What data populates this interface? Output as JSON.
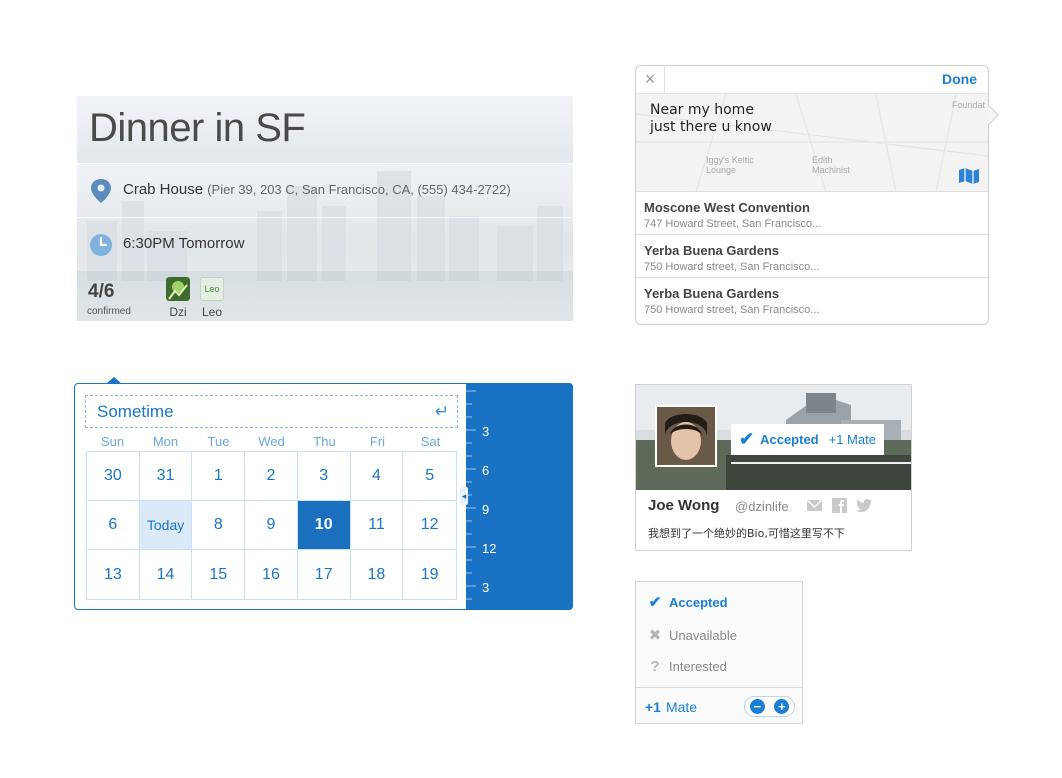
{
  "event": {
    "title": "Dinner in SF",
    "place_name": "Crab House",
    "place_detail": "(Pier 39, 203 C, San Francisco, CA, (555) 434-2722)",
    "time": "6:30PM Tomorrow",
    "confirmed_count": "4/6",
    "confirmed_label": "confirmed",
    "attendees": [
      {
        "name": "Dzi",
        "avatar_label": ""
      },
      {
        "name": "Leo",
        "avatar_label": "Leo"
      }
    ]
  },
  "location_popover": {
    "close_icon": "×",
    "done_label": "Done",
    "note": "Near my home\njust there u know",
    "map_labels": [
      "Iggy's Keltic Lounge",
      "Edith Machinist",
      "Foundat"
    ],
    "results": [
      {
        "name": "Moscone West Convention",
        "address": "747 Howard Street, San Francisco..."
      },
      {
        "name": "Yerba Buena Gardens",
        "address": "750 Howard street, San Francisco..."
      },
      {
        "name": "Yerba Buena Gardens",
        "address": "750 Howard street, San Francisco..."
      }
    ]
  },
  "calendar": {
    "input_value": "Sometime",
    "return_icon": "↵",
    "weekdays": [
      "Sun",
      "Mon",
      "Tue",
      "Wed",
      "Thu",
      "Fri",
      "Sat"
    ],
    "days": [
      "30",
      "31",
      "1",
      "2",
      "3",
      "4",
      "5",
      "6",
      "Today",
      "8",
      "9",
      "10",
      "11",
      "12",
      "13",
      "14",
      "15",
      "16",
      "17",
      "18",
      "19"
    ],
    "today_label": "Today",
    "selected_day": "10",
    "time_labels": [
      "3",
      "6",
      "9",
      "12",
      "3"
    ]
  },
  "profile": {
    "name": "Joe Wong",
    "handle": "@dzinlife",
    "accepted_label": "Accepted",
    "mate_label": "+1 Mate",
    "bio": "我想到了一个绝妙的Bio,可惜这里写不下"
  },
  "rsvp": {
    "options": [
      {
        "label": "Accepted",
        "mark": "✔",
        "active": true
      },
      {
        "label": "Unavailable",
        "mark": "✖",
        "active": false
      },
      {
        "label": "Interested",
        "mark": "?",
        "active": false
      }
    ],
    "mate_count": "+1",
    "mate_label": "Mate",
    "minus": "−",
    "plus": "+"
  },
  "colors": {
    "accent": "#1a7fd4",
    "calendar_blue": "#1a72c4",
    "selected": "#1a6fbe"
  }
}
